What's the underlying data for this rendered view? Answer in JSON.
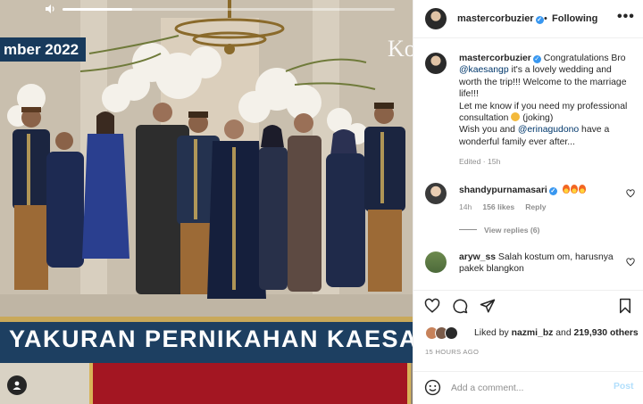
{
  "media": {
    "date_overlay": "mber 2022",
    "corner_text": "Ko",
    "banner_text": "YAKURAN PERNIKAHAN KAESANG",
    "video_progress": 0.21,
    "icons": [
      "volume-icon",
      "user-tag-icon"
    ]
  },
  "header": {
    "username": "mastercorbuzier",
    "dot": "•",
    "follow_status": "Following",
    "more": "•••"
  },
  "caption": {
    "username": "mastercorbuzier",
    "part1": " Congratulations Bro ",
    "mention1": "@kaesangp",
    "part2": " it's a lovely wedding and worth the trip!!! Welcome to the marriage life!!!",
    "part3": "Let me know if you need my professional consultation ",
    "part4": " (joking)",
    "part5": "Wish you and ",
    "mention2": "@erinagudono",
    "part6": " have a wonderful family ever after...",
    "meta": "Edited · 15h"
  },
  "comments": [
    {
      "username": "shandypurnamasari",
      "text": "",
      "time": "14h",
      "likes": "156 likes",
      "reply": "Reply",
      "view_replies": "View replies (6)"
    },
    {
      "username": "aryw_ss",
      "text": "Salah kostum om, harusnya pakek blangkon"
    }
  ],
  "actions": {
    "liked_by_prefix": "Liked by ",
    "liked_by_user": "nazmi_bz",
    "liked_by_mid": " and ",
    "liked_by_count": "219,930 others",
    "time_ago": "15 HOURS AGO",
    "comment_placeholder": "Add a comment...",
    "post_label": "Post"
  },
  "colors": {
    "banner": "#1d3f61",
    "verified": "#3897f0",
    "mention": "#00376b",
    "post_disabled": "#b2dffc",
    "carpet": "#a31622"
  }
}
